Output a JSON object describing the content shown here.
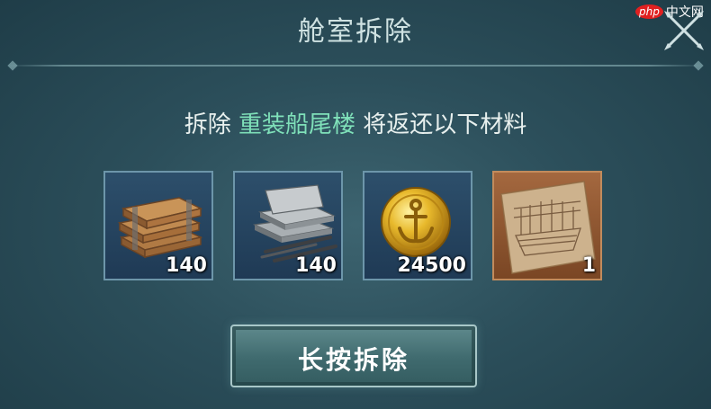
{
  "dialog": {
    "title": "舱室拆除",
    "message_prefix": "拆除",
    "message_target": "重装船尾楼",
    "message_suffix": "将返还以下材料"
  },
  "watermark": {
    "logo": "php",
    "text": "中文网"
  },
  "items": [
    {
      "name": "wood-planks",
      "icon": "wood-planks-icon",
      "quantity": "140",
      "rarity": "common"
    },
    {
      "name": "steel-plates",
      "icon": "steel-plates-icon",
      "quantity": "140",
      "rarity": "common"
    },
    {
      "name": "gold-coin",
      "icon": "anchor-gold-coin-icon",
      "quantity": "24500",
      "rarity": "common"
    },
    {
      "name": "ship-blueprint",
      "icon": "ship-blueprint-icon",
      "quantity": "1",
      "rarity": "rare"
    }
  ],
  "action_button": {
    "label": "长按拆除"
  },
  "colors": {
    "highlight": "#7fe0b9",
    "rare_border": "#c28b5c",
    "common_border": "#6d96aa"
  }
}
